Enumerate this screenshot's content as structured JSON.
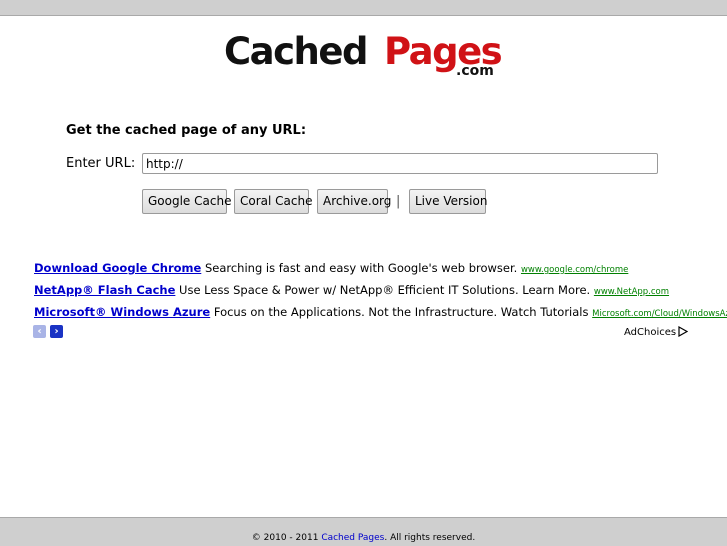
{
  "logo": {
    "part1": "Cached",
    "part2": "Pages",
    "part3": ".com"
  },
  "form": {
    "heading": "Get the cached page of any URL:",
    "url_label": "Enter URL:",
    "url_value": "http://"
  },
  "buttons": {
    "google_cache": "Google Cache",
    "coral_cache": "Coral Cache",
    "archive_org": "Archive.org",
    "separator": "|",
    "live_version": "Live Version"
  },
  "ads": [
    {
      "title": "Download Google Chrome",
      "desc": "Searching is fast and easy with Google's web browser.",
      "url": "www.google.com/chrome"
    },
    {
      "title": "NetApp® Flash Cache",
      "desc": "Use Less Space & Power w/ NetApp® Efficient IT Solutions. Learn More.",
      "url": "www.NetApp.com"
    },
    {
      "title": "Microsoft® Windows Azure",
      "desc": "Focus on the Applications. Not the Infrastructure. Watch Tutorials",
      "url": "Microsoft.com/Cloud/WindowsAzure"
    }
  ],
  "ad_nav": {
    "prev_glyph": "‹",
    "next_glyph": "›"
  },
  "adchoices": "AdChoices",
  "footer": {
    "prefix": "© 2010 - 2011",
    "link": "Cached Pages",
    "suffix": ". All rights reserved."
  },
  "colors": {
    "logo_red": "#d01216",
    "link_blue": "#0000cc",
    "ad_url_green": "#008000"
  }
}
